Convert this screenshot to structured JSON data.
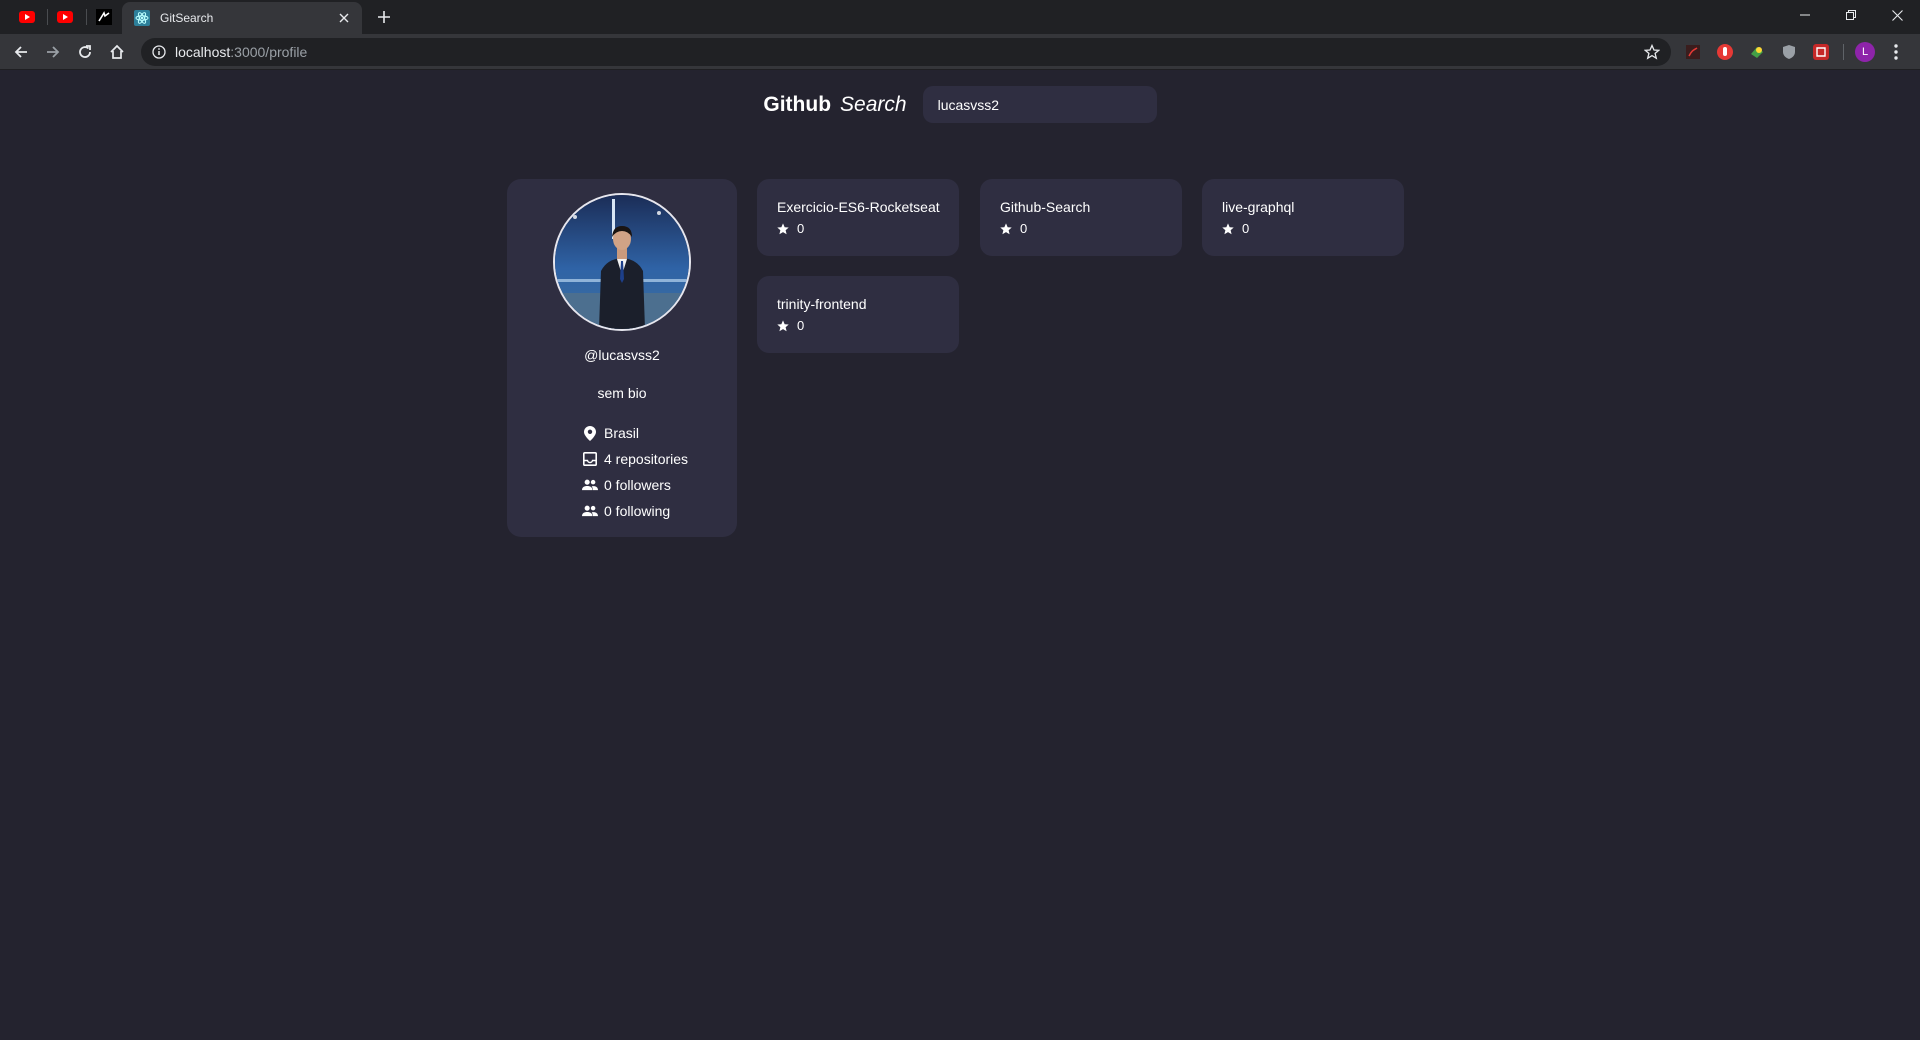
{
  "browser": {
    "tab_title": "GitSearch",
    "url_host": "localhost",
    "url_path": ":3000/profile",
    "profile_initial": "L"
  },
  "header": {
    "logo_bold": "Github",
    "logo_italic": "Search",
    "search_value": "lucasvss2"
  },
  "profile": {
    "username": "@lucasvss2",
    "bio": "sem bio",
    "location": "Brasil",
    "repositories": "4 repositories",
    "followers": "0 followers",
    "following": "0 following"
  },
  "repos": [
    {
      "name": "Exercicio-ES6-Rocketseat",
      "stars": "0"
    },
    {
      "name": "Github-Search",
      "stars": "0"
    },
    {
      "name": "live-graphql",
      "stars": "0"
    },
    {
      "name": "trinity-frontend",
      "stars": "0"
    }
  ],
  "colors": {
    "background": "#24232f",
    "card": "#2f2e41",
    "chrome_dark": "#202124",
    "chrome_toolbar": "#35363a"
  }
}
